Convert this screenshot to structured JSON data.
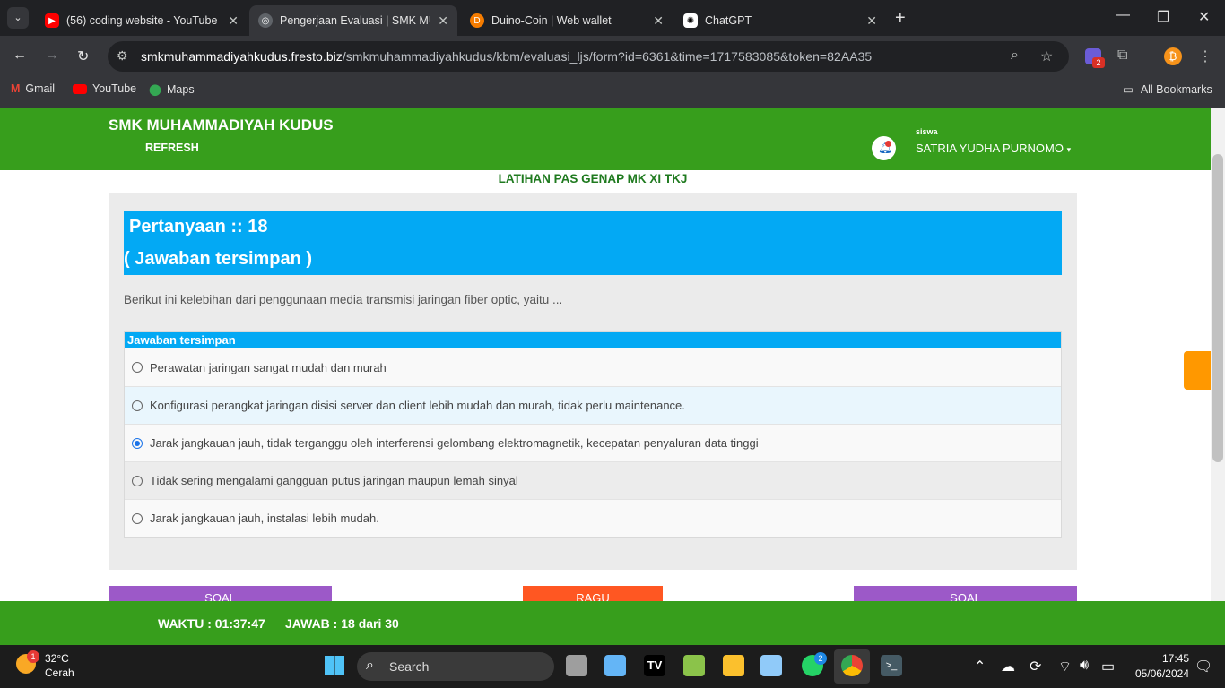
{
  "browser": {
    "tabs": [
      {
        "label": "(56) coding website - YouTube",
        "color": "#ff0000"
      },
      {
        "label": "Pengerjaan Evaluasi | SMK MUH",
        "color": "#9aa0a6"
      },
      {
        "label": "Duino-Coin | Web wallet",
        "color": "#f57c00"
      },
      {
        "label": "ChatGPT",
        "color": "#ffffff"
      }
    ],
    "url_host": "smkmuhammadiyahkudus.fresto.biz",
    "url_path": "/smkmuhammadiyahkudus/kbm/evaluasi_ljs/form?id=6361&time=1717583085&token=82AA35",
    "bookmarks": [
      "Gmail",
      "YouTube",
      "Maps"
    ],
    "all_bookmarks": "All Bookmarks",
    "ext_badge": "2"
  },
  "header": {
    "school": "SMK MUHAMMADIYAH KUDUS",
    "refresh": "REFRESH",
    "role": "siswa",
    "user": "SATRIA YUDHA PURNOMO"
  },
  "exam": {
    "title": "LATIHAN PAS GENAP MK XI TKJ",
    "question_label": "Pertanyaan :: 18",
    "saved_label": "( Jawaban tersimpan )",
    "question": "Berikut ini kelebihan dari penggunaan media transmisi jaringan fiber optic, yaitu ...",
    "answers_header": "Jawaban tersimpan",
    "options": [
      "Perawatan jaringan sangat mudah dan murah",
      "Konfigurasi perangkat jaringan disisi server dan client lebih mudah dan murah, tidak perlu maintenance.",
      "Jarak jangkauan jauh, tidak terganggu oleh interferensi gelombang elektromagnetik, kecepatan penyaluran data tinggi",
      "Tidak sering mengalami gangguan putus jaringan maupun lemah sinyal",
      "Jarak jangkauan jauh, instalasi lebih mudah."
    ],
    "selected": 2,
    "buttons": {
      "prev": "SOAL",
      "doubt": "RAGU",
      "next": "SOAL"
    }
  },
  "footer": {
    "timer": "WAKTU : 01:37:47",
    "answered": "JAWAB : 18 dari 30"
  },
  "taskbar": {
    "temp": "32°C",
    "weather": "Cerah",
    "weather_badge": "1",
    "search": "Search",
    "time": "17:45",
    "date": "05/06/2024",
    "whatsapp_badge": "2"
  },
  "colors": {
    "green": "#379e1c",
    "blue": "#03a9f4",
    "orange": "#ff9800",
    "purple": "#9c59c8"
  }
}
